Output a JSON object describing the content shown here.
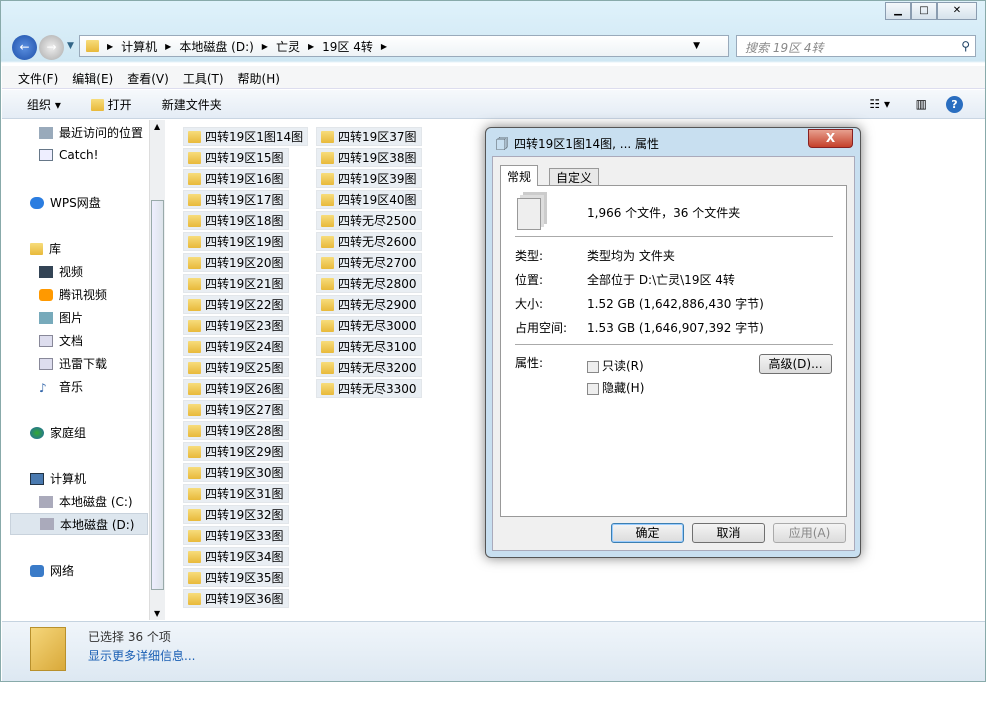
{
  "address": {
    "crumbs": [
      "计算机",
      "本地磁盘 (D:)",
      "亡灵",
      "19区 4转"
    ]
  },
  "search": {
    "placeholder": "搜索 19区 4转"
  },
  "menu": [
    "文件(F)",
    "编辑(E)",
    "查看(V)",
    "工具(T)",
    "帮助(H)"
  ],
  "toolbar": {
    "organize": "组织 ▾",
    "open": "打开",
    "new_folder": "新建文件夹"
  },
  "nav": {
    "recent": "最近访问的位置",
    "catch": "Catch!",
    "wps": "WPS网盘",
    "library": "库",
    "video": "视频",
    "tencent": "腾讯视频",
    "pictures": "图片",
    "docs": "文档",
    "xunlei": "迅雷下载",
    "music": "音乐",
    "homegroup": "家庭组",
    "computer": "计算机",
    "drive_c": "本地磁盘 (C:)",
    "drive_d": "本地磁盘 (D:)",
    "network": "网络"
  },
  "folders_col1": [
    "四转19区1图14图",
    "四转19区15图",
    "四转19区16图",
    "四转19区17图",
    "四转19区18图",
    "四转19区19图",
    "四转19区20图",
    "四转19区21图",
    "四转19区22图",
    "四转19区23图",
    "四转19区24图",
    "四转19区25图",
    "四转19区26图",
    "四转19区27图",
    "四转19区28图",
    "四转19区29图",
    "四转19区30图",
    "四转19区31图",
    "四转19区32图",
    "四转19区33图",
    "四转19区34图",
    "四转19区35图",
    "四转19区36图"
  ],
  "folders_col2": [
    "四转19区37图",
    "四转19区38图",
    "四转19区39图",
    "四转19区40图",
    "四转无尽2500",
    "四转无尽2600",
    "四转无尽2700",
    "四转无尽2800",
    "四转无尽2900",
    "四转无尽3000",
    "四转无尽3100",
    "四转无尽3200",
    "四转无尽3300"
  ],
  "status": {
    "selected": "已选择 36 个项",
    "more": "显示更多详细信息..."
  },
  "dialog": {
    "title": "四转19区1图14图, ... 属性",
    "close": "X",
    "tab_general": "常规",
    "tab_custom": "自定义",
    "summary": "1,966 个文件，36 个文件夹",
    "type_label": "类型:",
    "type_value": "类型均为 文件夹",
    "loc_label": "位置:",
    "loc_value": "全部位于 D:\\亡灵\\19区 4转",
    "size_label": "大小:",
    "size_value": "1.52 GB (1,642,886,430 字节)",
    "disk_label": "占用空间:",
    "disk_value": "1.53 GB (1,646,907,392 字节)",
    "attr_label": "属性:",
    "readonly": "只读(R)",
    "hidden": "隐藏(H)",
    "advanced": "高级(D)...",
    "ok": "确定",
    "cancel": "取消",
    "apply": "应用(A)"
  }
}
